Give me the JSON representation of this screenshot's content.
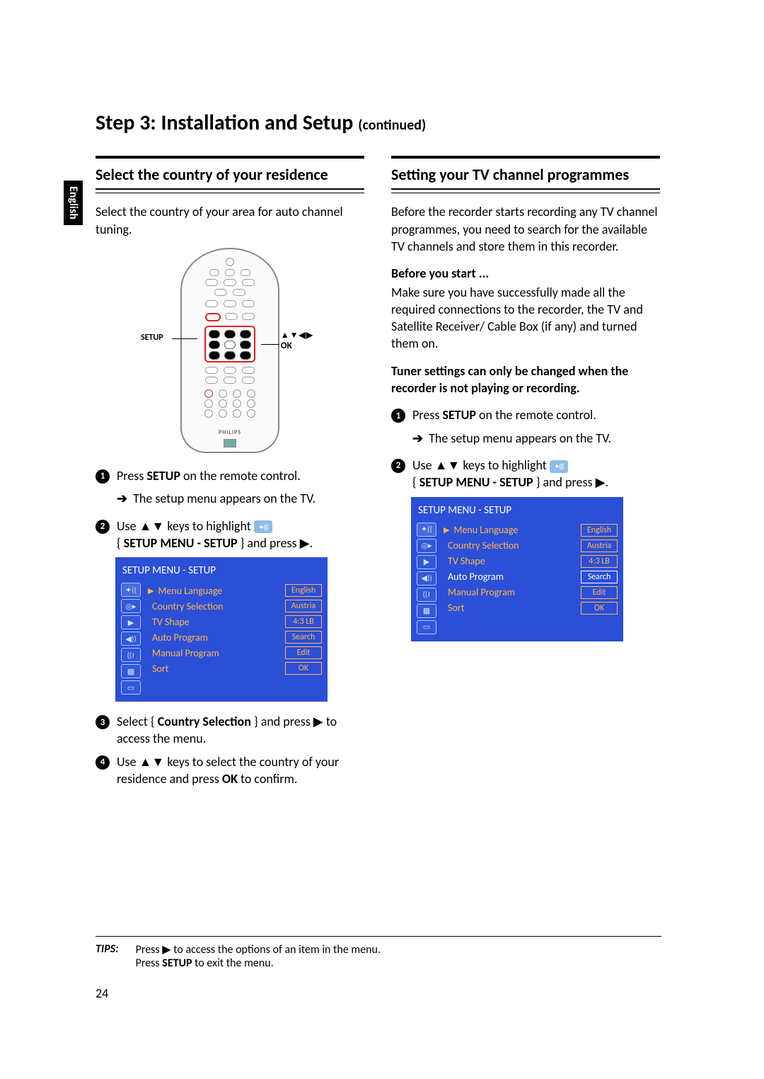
{
  "lang_tab": "English",
  "page_title_main": "Step 3: Installation and Setup",
  "page_title_cont": "(continued)",
  "left": {
    "heading": "Select the country of your residence",
    "intro": "Select the country of your area for auto channel tuning.",
    "remote": {
      "label_left": "SETUP",
      "label_right_arrows": "▲▼◀▶",
      "label_right_ok": "OK",
      "brand": "PHILIPS"
    },
    "steps": {
      "s1_a": "Press ",
      "s1_b": "SETUP",
      "s1_c": " on the remote control.",
      "s1_res": "The setup menu appears on the TV.",
      "s2_a": "Use ▲▼ keys to highlight ",
      "s2_b": "{ ",
      "s2_c": "SETUP MENU - SETUP",
      "s2_d": " } and press ▶.",
      "s3_a": "Select { ",
      "s3_b": "Country Selection",
      "s3_c": " } and press ▶ to access the menu.",
      "s4_a": "Use ▲▼ keys to select the country of your residence and press ",
      "s4_b": "OK",
      "s4_c": " to confirm."
    },
    "menu": {
      "title": "SETUP MENU - SETUP",
      "rows": [
        {
          "label": "Menu Language",
          "value": "English",
          "selected": false
        },
        {
          "label": "Country Selection",
          "value": "Austria",
          "selected": false
        },
        {
          "label": "TV Shape",
          "value": "4:3 LB",
          "selected": false
        },
        {
          "label": "Auto Program",
          "value": "Search",
          "selected": false
        },
        {
          "label": "Manual Program",
          "value": "Edit",
          "selected": false
        },
        {
          "label": "Sort",
          "value": "OK",
          "selected": false
        }
      ]
    }
  },
  "right": {
    "heading": "Setting your TV channel programmes",
    "intro": "Before the recorder starts recording any TV channel programmes, you need to search for the available TV channels and store them in this recorder.",
    "before_label": "Before you start ...",
    "before_text": "Make sure you have successfully made all the required connections to the recorder, the TV and Satellite Receiver/ Cable Box (if any) and turned them on.",
    "tuner_warning": "Tuner settings can only be changed when the recorder is not playing or recording.",
    "steps": {
      "s1_a": "Press ",
      "s1_b": "SETUP",
      "s1_c": " on the remote control.",
      "s1_res": "The setup menu appears on the TV.",
      "s2_a": "Use ▲▼ keys to highlight ",
      "s2_b": "{ ",
      "s2_c": "SETUP MENU - SETUP",
      "s2_d": " } and press ▶."
    },
    "menu": {
      "title": "SETUP MENU - SETUP",
      "rows": [
        {
          "label": "Menu Language",
          "value": "English",
          "selected": false
        },
        {
          "label": "Country Selection",
          "value": "Austria",
          "selected": false
        },
        {
          "label": "TV Shape",
          "value": "4:3 LB",
          "selected": false
        },
        {
          "label": "Auto Program",
          "value": "Search",
          "selected": true
        },
        {
          "label": "Manual Program",
          "value": "Edit",
          "selected": false
        },
        {
          "label": "Sort",
          "value": "OK",
          "selected": false
        }
      ]
    }
  },
  "tips": {
    "label": "TIPS:",
    "line1_a": "Press ▶ to access the options of an item in the menu.",
    "line2_a": "Press ",
    "line2_b": "SETUP",
    "line2_c": " to exit the menu."
  },
  "page_number": "24"
}
